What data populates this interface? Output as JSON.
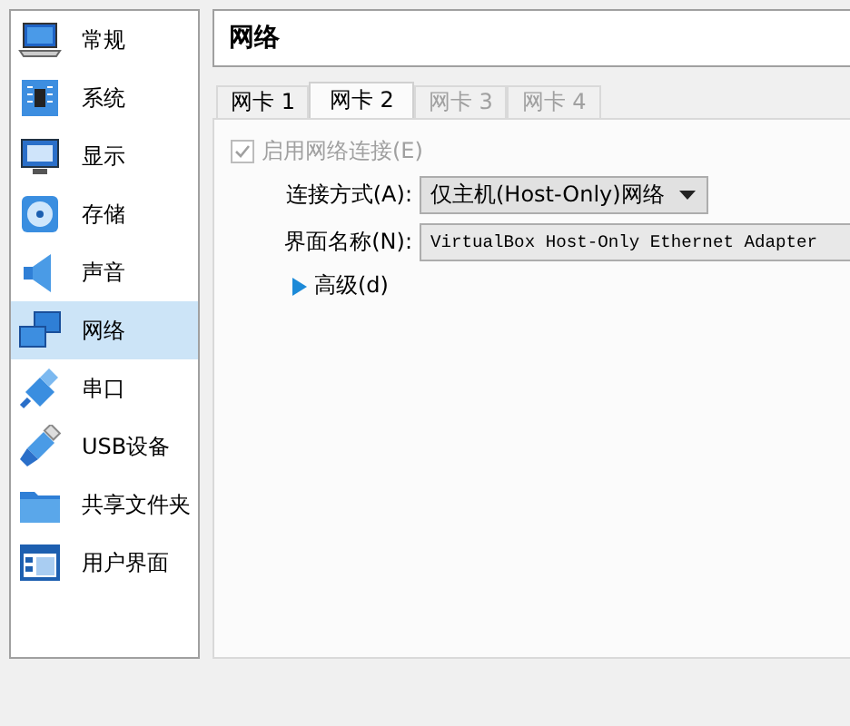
{
  "sidebar": {
    "items": [
      {
        "label": "常规",
        "selected": false
      },
      {
        "label": "系统",
        "selected": false
      },
      {
        "label": "显示",
        "selected": false
      },
      {
        "label": "存储",
        "selected": false
      },
      {
        "label": "声音",
        "selected": false
      },
      {
        "label": "网络",
        "selected": true
      },
      {
        "label": "串口",
        "selected": false
      },
      {
        "label": "USB设备",
        "selected": false
      },
      {
        "label": "共享文件夹",
        "selected": false
      },
      {
        "label": "用户界面",
        "selected": false
      }
    ]
  },
  "page": {
    "title": "网络",
    "tabs": [
      {
        "label": "网卡 1",
        "selected": false,
        "disabled": false
      },
      {
        "label": "网卡 2",
        "selected": true,
        "disabled": false
      },
      {
        "label": "网卡 3",
        "selected": false,
        "disabled": true
      },
      {
        "label": "网卡 4",
        "selected": false,
        "disabled": true
      }
    ],
    "enable_checkbox": {
      "label": "启用网络连接(E)",
      "checked": true,
      "disabled": true
    },
    "attached_to": {
      "label": "连接方式(A):",
      "value": "仅主机(Host-Only)网络"
    },
    "interface_name": {
      "label": "界面名称(N):",
      "value": "VirtualBox Host-Only Ethernet Adapter"
    },
    "advanced": {
      "label": "高级(d)",
      "expanded": false
    }
  }
}
